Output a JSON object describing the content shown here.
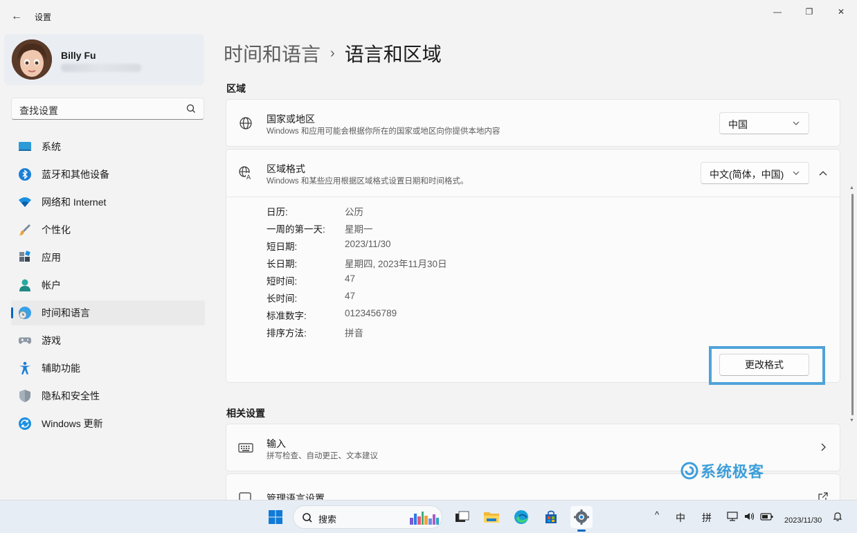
{
  "window": {
    "title": "设置",
    "back_glyph": "←",
    "min_glyph": "—",
    "max_glyph": "❐",
    "close_glyph": "✕"
  },
  "profile": {
    "name": "Billy Fu"
  },
  "search": {
    "placeholder": "查找设置"
  },
  "sidebar": {
    "items": [
      {
        "label": "系统",
        "icon": "system-icon"
      },
      {
        "label": "蓝牙和其他设备",
        "icon": "bluetooth-icon"
      },
      {
        "label": "网络和 Internet",
        "icon": "wifi-icon"
      },
      {
        "label": "个性化",
        "icon": "brush-icon"
      },
      {
        "label": "应用",
        "icon": "apps-icon"
      },
      {
        "label": "帐户",
        "icon": "account-icon"
      },
      {
        "label": "时间和语言",
        "icon": "time-language-icon",
        "active": true
      },
      {
        "label": "游戏",
        "icon": "gamepad-icon"
      },
      {
        "label": "辅助功能",
        "icon": "accessibility-icon"
      },
      {
        "label": "隐私和安全性",
        "icon": "shield-icon"
      },
      {
        "label": "Windows 更新",
        "icon": "update-icon"
      }
    ]
  },
  "breadcrumb": {
    "parent": "时间和语言",
    "sep": "›",
    "current": "语言和区域"
  },
  "region": {
    "heading": "区域",
    "country": {
      "title": "国家或地区",
      "subtitle": "Windows 和应用可能会根据你所在的国家或地区向你提供本地内容",
      "value": "中国"
    },
    "format": {
      "title": "区域格式",
      "subtitle": "Windows 和某些应用根据区域格式设置日期和时间格式。",
      "value": "中文(简体，中国)",
      "details": [
        {
          "label": "日历:",
          "value": "公历"
        },
        {
          "label": "一周的第一天:",
          "value": "星期一"
        },
        {
          "label": "短日期:",
          "value": "2023/11/30"
        },
        {
          "label": "长日期:",
          "value": "星期四, 2023年11月30日"
        },
        {
          "label": "短时间:",
          "value": "47"
        },
        {
          "label": "长时间:",
          "value": "47"
        },
        {
          "label": "标准数字:",
          "value": "0123456789"
        },
        {
          "label": "排序方法:",
          "value": "拼音"
        }
      ],
      "change_button": "更改格式"
    }
  },
  "related": {
    "heading": "相关设置",
    "input": {
      "title": "输入",
      "subtitle": "拼写检查、自动更正、文本建议"
    },
    "manage_lang": {
      "title": "管理语言设置"
    }
  },
  "watermark": {
    "text": "系统极客"
  },
  "taskbar": {
    "search_label": "搜索",
    "tray": {
      "ime_lang": "中",
      "ime_mode": "拼",
      "up_glyph": "^"
    },
    "date": "2023/11/30"
  },
  "colors": {
    "accent": "#0067c0",
    "highlight": "#4fa3d9",
    "watermark": "#1d8fd6"
  }
}
